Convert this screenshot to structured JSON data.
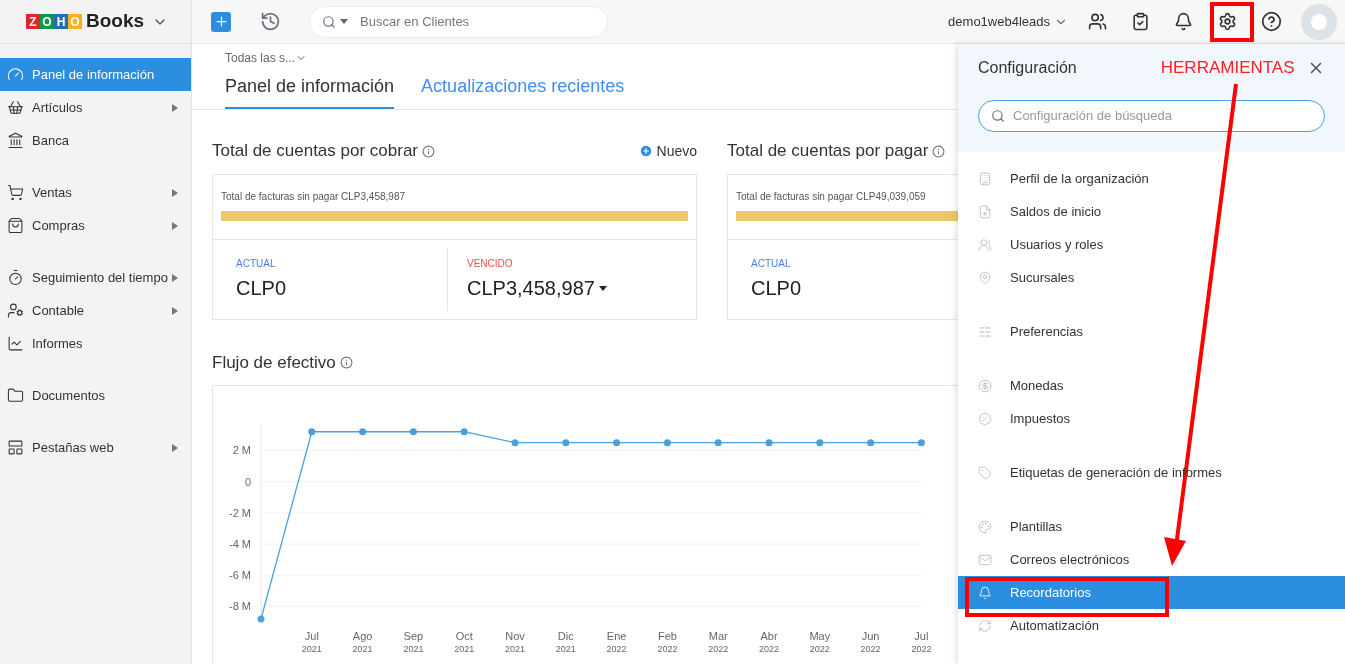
{
  "brand": {
    "logo_letters": [
      "Z",
      "O",
      "H",
      "O"
    ],
    "product": "Books"
  },
  "topbar": {
    "search_placeholder": "Buscar en Clientes",
    "org": "demo1web4leads"
  },
  "sidebar": {
    "groups": [
      [
        {
          "label": "Panel de información",
          "selected": true,
          "has_submenu": false
        },
        {
          "label": "Artículos",
          "selected": false,
          "has_submenu": true
        },
        {
          "label": "Banca",
          "selected": false,
          "has_submenu": false
        }
      ],
      [
        {
          "label": "Ventas",
          "selected": false,
          "has_submenu": true
        },
        {
          "label": "Compras",
          "selected": false,
          "has_submenu": true
        }
      ],
      [
        {
          "label": "Seguimiento del tiempo",
          "selected": false,
          "has_submenu": true
        },
        {
          "label": "Contable",
          "selected": false,
          "has_submenu": true
        },
        {
          "label": "Informes",
          "selected": false,
          "has_submenu": false
        }
      ],
      [
        {
          "label": "Documentos",
          "selected": false,
          "has_submenu": false
        }
      ],
      [
        {
          "label": "Pestañas web",
          "selected": false,
          "has_submenu": true
        }
      ]
    ]
  },
  "branch_filter": "Todas las s...",
  "tabs": [
    {
      "label": "Panel de información",
      "selected": true
    },
    {
      "label": "Actualizaciones recientes",
      "selected": false
    }
  ],
  "cards": [
    {
      "title": "Total de cuentas por cobrar",
      "new_button": "Nuevo",
      "unpaid": "Total de facturas sin pagar CLP3,458,987",
      "level": 1,
      "current_label": "ACTUAL",
      "current_value": "CLP0",
      "overdue_label": "VENCIDO",
      "overdue_value": "CLP3,458,987"
    },
    {
      "title": "Total de cuentas por pagar",
      "unpaid": "Total de facturas sin pagar CLP49,039,059",
      "level": 1,
      "current_label": "ACTUAL",
      "current_value": "CLP0"
    }
  ],
  "cash_flow": {
    "title": "Flujo de efectivo",
    "chart_data": {
      "type": "line",
      "categories": [
        null,
        "Jul $_{2021}$",
        "Ago $_{2021}$",
        "Sep $_{2021}$",
        "Oct $_{2021}$",
        "Nov $_{2021}$",
        "Dic $_{2021}$",
        "Ene $_{2022}$",
        "Feb $_{2022}$",
        "Mar $_{2022}$",
        "Abr $_{2022}$",
        "May $_{2022}$",
        "Jun $_{2022}$",
        "Jul $_{2022}$"
      ],
      "values": [
        -8.8,
        3.2,
        3.2,
        3.2,
        3.2,
        2.5,
        2.5,
        2.5,
        2.5,
        2.5,
        2.5,
        2.5,
        2.5,
        2.5
      ],
      "ylim": [
        -9,
        3.6
      ],
      "grid": true,
      "marker": true,
      "yticks": [
        {
          "value": 2,
          "label": "2 M"
        },
        {
          "value": 0,
          "label": "0"
        },
        {
          "value": -2,
          "label": "-2 M"
        },
        {
          "value": -4,
          "label": "-4 M"
        },
        {
          "value": -6,
          "label": "-6 M"
        },
        {
          "value": -8,
          "label": "-8 M"
        }
      ]
    }
  },
  "settings": {
    "title": "Configuración",
    "search_placeholder": "Configuración de búsqueda",
    "groups": [
      [
        {
          "label": "Perfil de la organización",
          "selected": false
        },
        {
          "label": "Saldos de inicio",
          "selected": false
        },
        {
          "label": "Usuarios y roles",
          "selected": false
        },
        {
          "label": "Sucursales",
          "selected": false
        }
      ],
      [
        {
          "label": "Preferencias",
          "selected": false
        }
      ],
      [
        {
          "label": "Monedas",
          "selected": false
        },
        {
          "label": "Impuestos",
          "selected": false
        }
      ],
      [
        {
          "label": "Etiquetas de generación de informes",
          "selected": false
        }
      ],
      [
        {
          "label": "Plantillas",
          "selected": false
        },
        {
          "label": "Correos electrónicos",
          "selected": false
        },
        {
          "label": "Recordatorios",
          "selected": true
        },
        {
          "label": "Automatización",
          "selected": false
        }
      ]
    ]
  },
  "annotation": {
    "label": "HERRAMIENTAS"
  }
}
